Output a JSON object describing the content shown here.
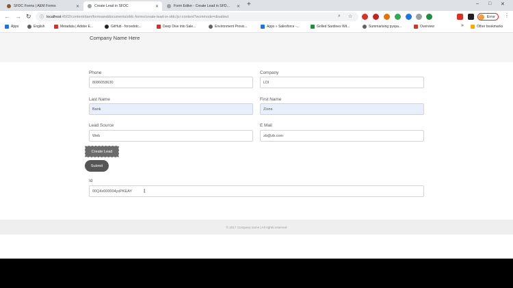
{
  "browser": {
    "tabs": [
      {
        "title": "SFDC Forms | AEM Forms",
        "fav_color": "#8a5a2b",
        "active": false
      },
      {
        "title": "Create Lead in SFDC",
        "fav_color": "#9aa0a6",
        "active": true
      },
      {
        "title": "Form Editor - Create Lead in SFD...",
        "fav_color": "#9aa0a6",
        "active": false
      }
    ],
    "new_tab": "+",
    "window_controls": [
      "–",
      "□",
      "✕"
    ],
    "nav": {
      "back": "←",
      "forward": "→",
      "reload": "↻"
    },
    "url_host": "localhost",
    "url_path": ":4502/content/dam/formsanddocuments/sfdc-forms/create-lead-in-sfdc/jcr:content?wcmmode=disabled",
    "profile_name": "Error",
    "extension_colors": [
      "#d93025",
      "#c5221f",
      "#e8710a",
      "#34a853",
      "#1a73e8",
      "#9aa0a6",
      "#1e8e3e",
      "#d93025",
      "#202124"
    ],
    "bookmarks": [
      {
        "label": "Apps",
        "color": "#1a73e8"
      },
      {
        "label": "English",
        "color": "#5f6368"
      },
      {
        "label": "Metadata | Adobe E...",
        "color": "#d93025"
      },
      {
        "label": "GitHub - forcedotc...",
        "color": "#202124"
      },
      {
        "label": "Deep Dive into Sale...",
        "color": "#d93025"
      },
      {
        "label": "Environment Provis...",
        "color": "#5f6368"
      },
      {
        "label": "Apps » Salesforce -...",
        "color": "#1a73e8"
      },
      {
        "label": "Grilled Sardines Wit...",
        "color": "#1e8e3e"
      },
      {
        "label": "Summarising pyspa...",
        "color": "#5f6368"
      },
      {
        "label": "Overview",
        "color": "#d93025"
      }
    ],
    "bookmarks_more": "»",
    "other_bookmarks": "Other bookmarks"
  },
  "page": {
    "company_name": "Company Name Here",
    "fields": {
      "phone": {
        "label": "Phone",
        "value": "8086058630"
      },
      "company": {
        "label": "Company",
        "value": "LDI"
      },
      "last_name": {
        "label": "Last Name",
        "value": "Bank"
      },
      "first_name": {
        "label": "First Name",
        "value": "Zions"
      },
      "lead_source": {
        "label": "Lead Source",
        "value": "Web"
      },
      "email": {
        "label": "E Mail",
        "value": "zb@zb.com"
      },
      "id": {
        "label": "Id",
        "value": "00Q4x000004ysPKEAY"
      }
    },
    "create_lead_button": "Create Lead",
    "submit_button": "Submit",
    "footer": "© 2017 Company name | All rights reserved"
  }
}
